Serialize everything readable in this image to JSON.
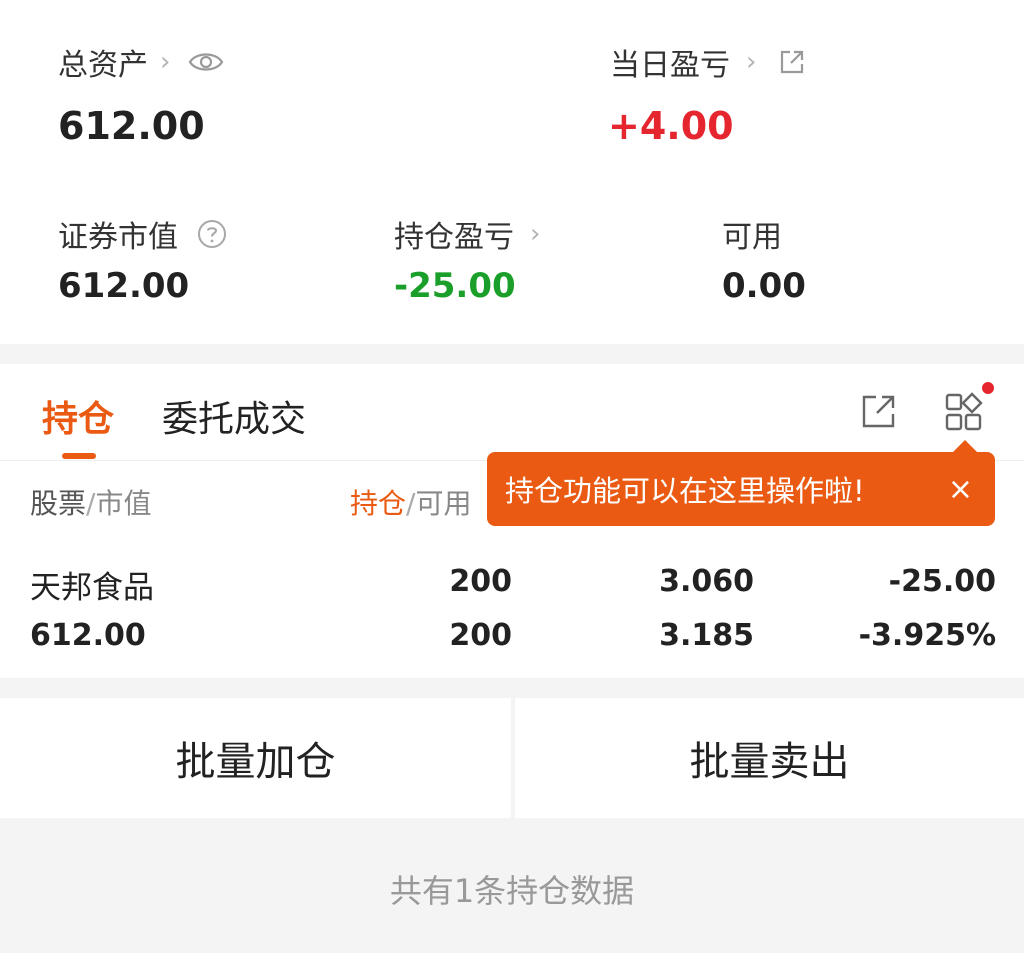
{
  "summary": {
    "total_assets_label": "总资产",
    "total_assets_value": "612.00",
    "daily_pnl_label": "当日盈亏",
    "daily_pnl_value": "+4.00",
    "market_value_label": "证券市值",
    "market_value_value": "612.00",
    "position_pnl_label": "持仓盈亏",
    "position_pnl_value": "-25.00",
    "available_label": "可用",
    "available_value": "0.00"
  },
  "tabs": [
    {
      "label": "持仓",
      "active": true
    },
    {
      "label": "委托成交",
      "active": false
    }
  ],
  "table": {
    "header_stock": "股票",
    "header_sep": "/",
    "header_market_value": "市值",
    "header_position": "持仓",
    "header_available": "可用",
    "rows": [
      {
        "name": "天邦食品",
        "market_value": "612.00",
        "position": "200",
        "available": "200",
        "price_top": "3.060",
        "price_bottom": "3.185",
        "pnl": "-25.00",
        "pnl_pct": "-3.925%"
      }
    ]
  },
  "tooltip": {
    "text": "持仓功能可以在这里操作啦!",
    "close": "×"
  },
  "buttons": {
    "batch_add": "批量加仓",
    "batch_sell": "批量卖出"
  },
  "footer": {
    "text": "共有1条持仓数据"
  },
  "colors": {
    "accent": "#ea5a13",
    "up": "#e5262f",
    "down": "#1a9f2a"
  },
  "icons": {
    "total_assets": "eye-icon",
    "daily_pnl": "share-out-icon",
    "market_value": "help-circle-icon",
    "toolbar_share": "share-out-icon",
    "toolbar_grid": "grid-apps-icon"
  }
}
